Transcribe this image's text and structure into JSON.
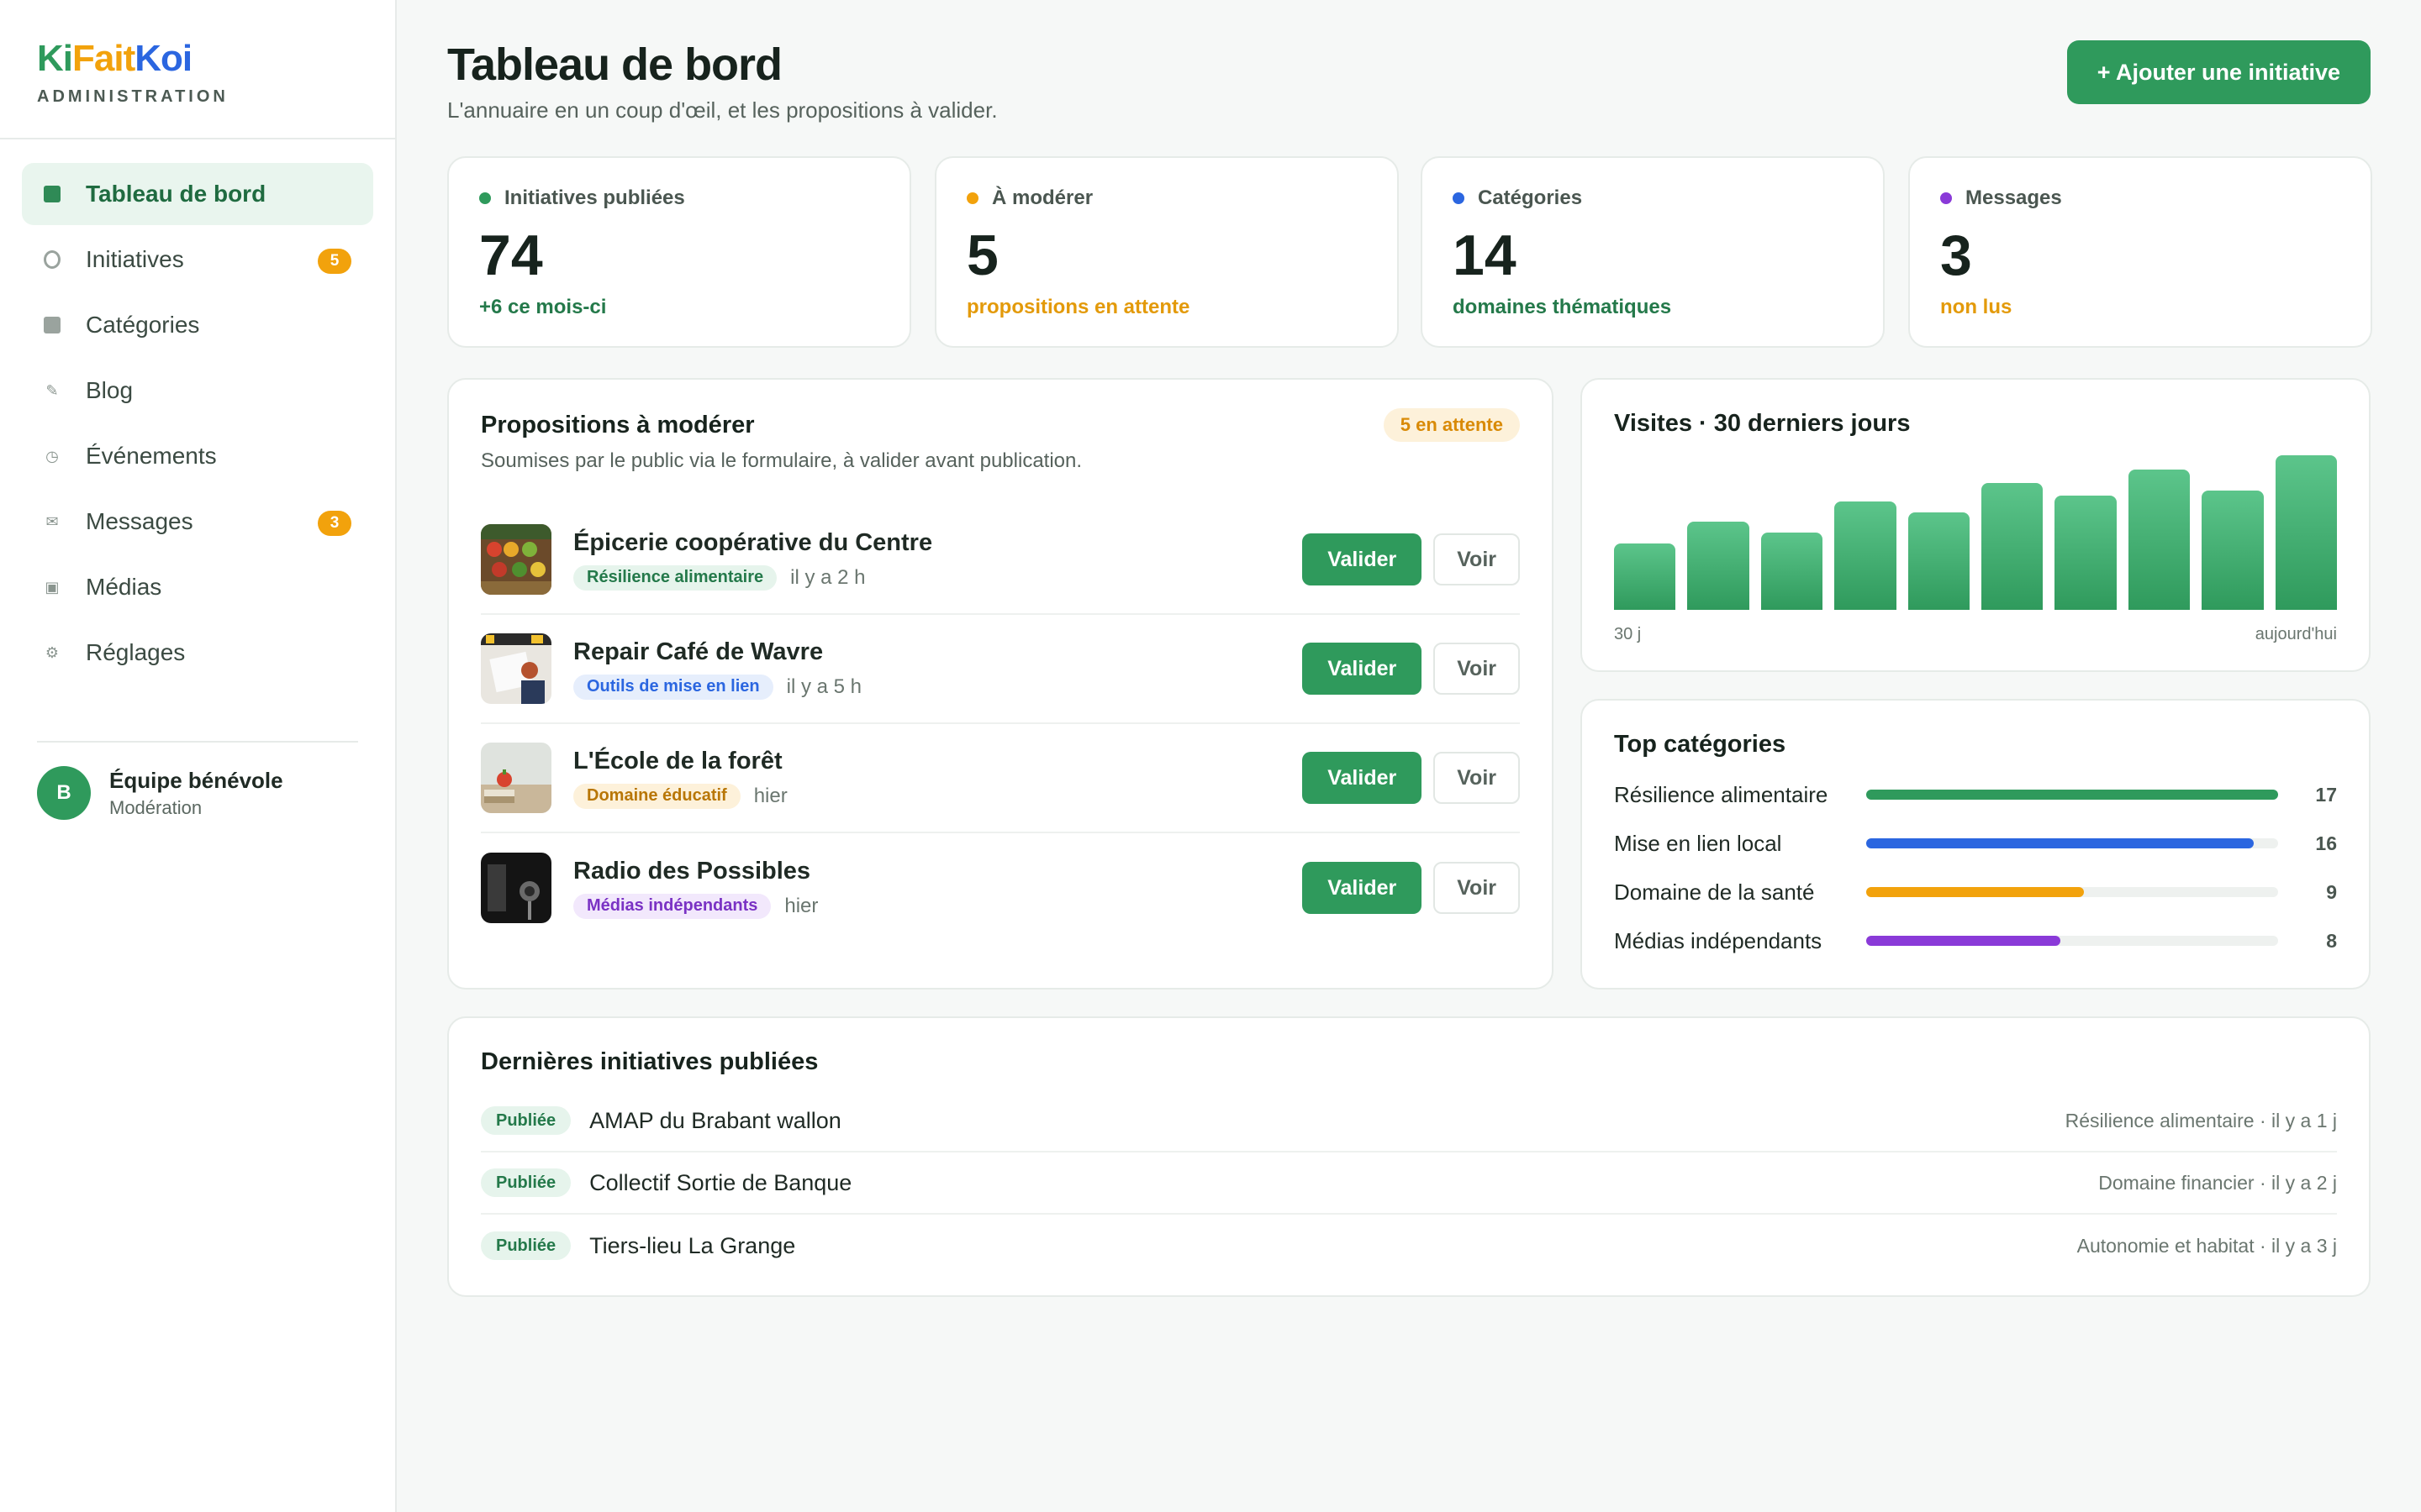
{
  "brand": {
    "logo_ki": "Ki",
    "logo_fait": "Fait",
    "logo_koi": "Koi",
    "subtitle": "ADMINISTRATION"
  },
  "sidebar": {
    "items": [
      {
        "label": "Tableau de bord",
        "icon": "dashboard-icon",
        "active": true
      },
      {
        "label": "Initiatives",
        "icon": "circle-icon",
        "badge": "5"
      },
      {
        "label": "Catégories",
        "icon": "category-icon"
      },
      {
        "label": "Blog",
        "icon": "pencil-icon"
      },
      {
        "label": "Événements",
        "icon": "clock-icon"
      },
      {
        "label": "Messages",
        "icon": "envelope-icon",
        "badge": "3"
      },
      {
        "label": "Médias",
        "icon": "image-icon"
      },
      {
        "label": "Réglages",
        "icon": "gear-icon"
      }
    ],
    "user": {
      "initial": "B",
      "name": "Équipe bénévole",
      "role": "Modération"
    }
  },
  "header": {
    "title": "Tableau de bord",
    "subtitle": "L'annuaire en un coup d'œil, et les propositions à valider.",
    "add_button": "+ Ajouter une initiative"
  },
  "stats": [
    {
      "label": "Initiatives publiées",
      "value": "74",
      "note": "+6 ce mois-ci",
      "color": "#2f9a5c",
      "note_color": "#24794a"
    },
    {
      "label": "À modérer",
      "value": "5",
      "note": "propositions en attente",
      "color": "#f2a20c",
      "note_color": "#e39a0a"
    },
    {
      "label": "Catégories",
      "value": "14",
      "note": "domaines thématiques",
      "color": "#2b66e0",
      "note_color": "#24794a"
    },
    {
      "label": "Messages",
      "value": "3",
      "note": "non lus",
      "color": "#8a3ad8",
      "note_color": "#e39a0a"
    }
  ],
  "moderation": {
    "title": "Propositions à modérer",
    "subtitle": "Soumises par le public via le formulaire, à valider avant publication.",
    "pending": "5 en attente",
    "validate_label": "Valider",
    "view_label": "Voir",
    "items": [
      {
        "name": "Épicerie coopérative du Centre",
        "tag": "Résilience alimentaire",
        "tag_bg": "#e6f4ec",
        "tag_color": "#24794a",
        "ago": "il y a 2 h"
      },
      {
        "name": "Repair Café de Wavre",
        "tag": "Outils de mise en lien",
        "tag_bg": "#e6eefc",
        "tag_color": "#2b66e0",
        "ago": "il y a 5 h"
      },
      {
        "name": "L'École de la forêt",
        "tag": "Domaine éducatif",
        "tag_bg": "#fdf1da",
        "tag_color": "#b87606",
        "ago": "hier"
      },
      {
        "name": "Radio des Possibles",
        "tag": "Médias indépendants",
        "tag_bg": "#f2e8fc",
        "tag_color": "#7a32c4",
        "ago": "hier"
      }
    ]
  },
  "visits": {
    "title": "Visites · 30 derniers jours",
    "axis_start": "30 j",
    "axis_end": "aujourd'hui"
  },
  "chart_data": {
    "type": "bar",
    "title": "Visites · 30 derniers jours",
    "categories": [
      "30 j",
      "",
      "",
      "",
      "",
      "",
      "",
      "",
      "",
      "aujourd'hui"
    ],
    "values": [
      43,
      57,
      50,
      70,
      63,
      82,
      74,
      91,
      77,
      100
    ],
    "ylim": [
      0,
      100
    ],
    "grid": false
  },
  "top_categories": {
    "title": "Top catégories",
    "items": [
      {
        "name": "Résilience alimentaire",
        "count": 17,
        "color": "#2f9a5c"
      },
      {
        "name": "Mise en lien local",
        "count": 16,
        "color": "#2b66e0"
      },
      {
        "name": "Domaine de la santé",
        "count": 9,
        "color": "#f2a20c"
      },
      {
        "name": "Médias indépendants",
        "count": 8,
        "color": "#8a3ad8"
      }
    ],
    "max": 17
  },
  "published": {
    "title": "Dernières initiatives publiées",
    "status_label": "Publiée",
    "items": [
      {
        "name": "AMAP du Brabant wallon",
        "meta": "Résilience alimentaire · il y a 1 j"
      },
      {
        "name": "Collectif Sortie de Banque",
        "meta": "Domaine financier · il y a 2 j"
      },
      {
        "name": "Tiers-lieu La Grange",
        "meta": "Autonomie et habitat · il y a 3 j"
      }
    ]
  }
}
